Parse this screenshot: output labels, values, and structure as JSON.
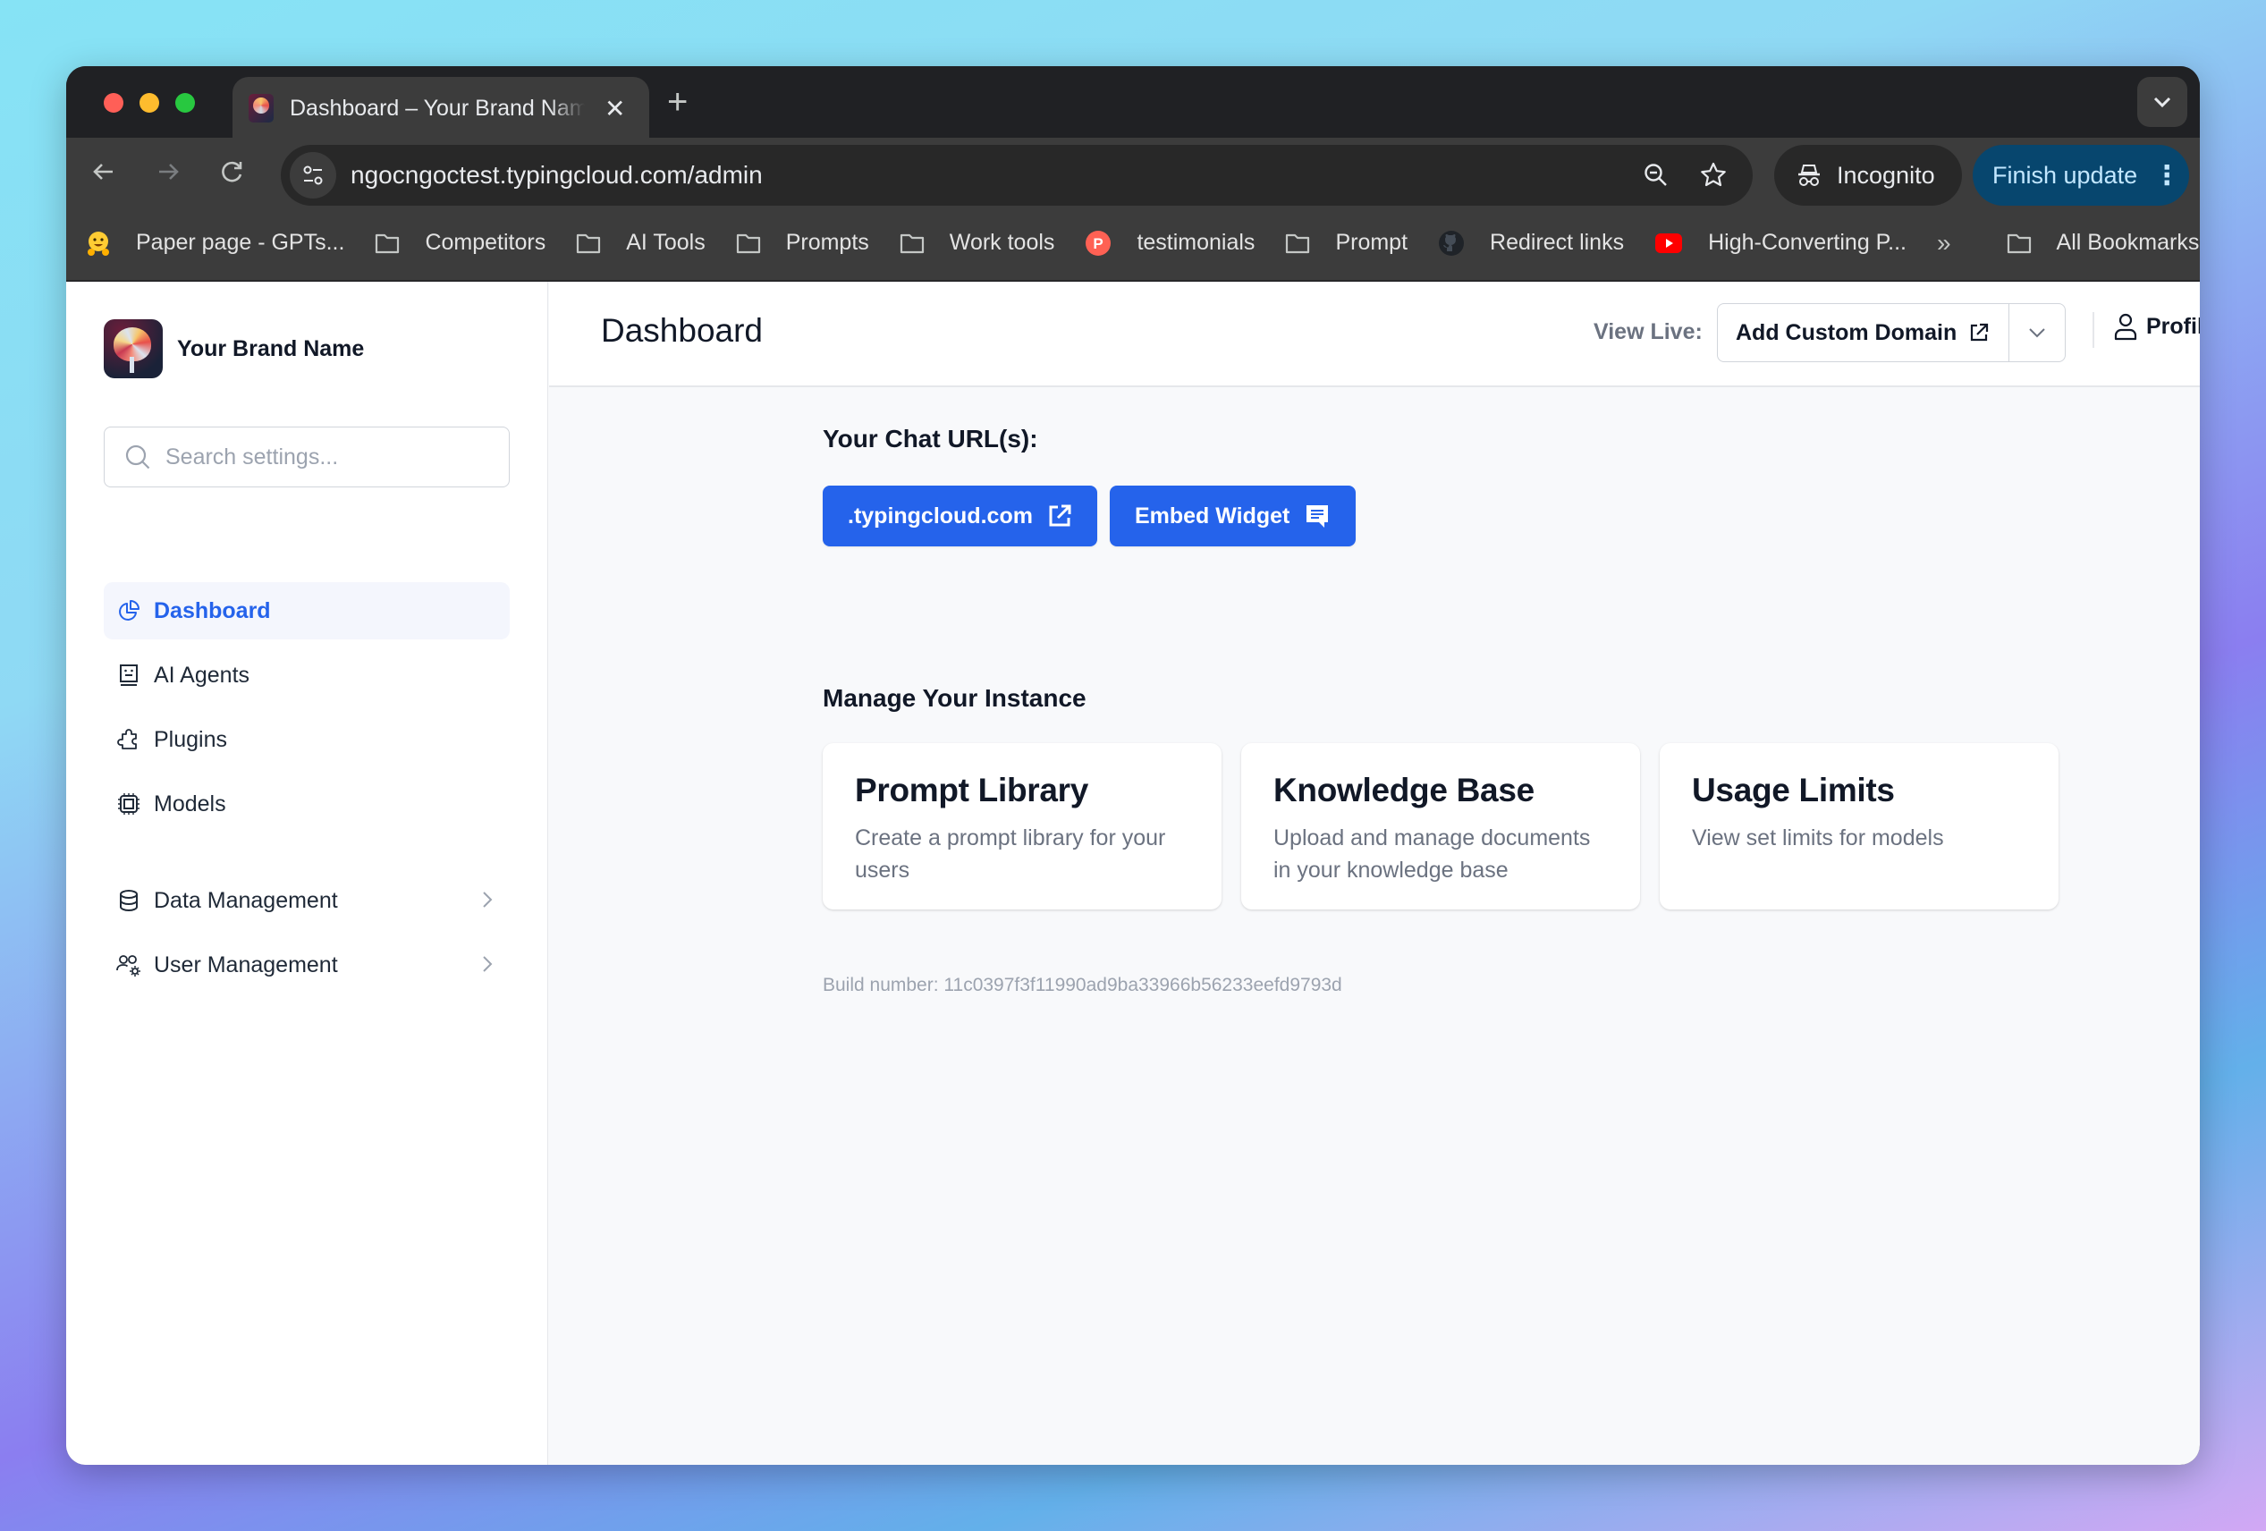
{
  "browser": {
    "tab_title": "Dashboard – Your Brand Name",
    "new_tab_symbol": "+",
    "close_symbol": "✕",
    "url": "ngocngoctest.typingcloud.com/admin",
    "incognito_label": "Incognito",
    "finish_update_label": "Finish update",
    "bookmarks": [
      {
        "label": "Paper page - GPTs...",
        "icon": "huggingface-icon"
      },
      {
        "label": "Competitors",
        "icon": "folder-icon"
      },
      {
        "label": "AI Tools",
        "icon": "folder-icon"
      },
      {
        "label": "Prompts",
        "icon": "folder-icon"
      },
      {
        "label": "Work tools",
        "icon": "folder-icon"
      },
      {
        "label": "testimonials",
        "icon": "producthunt-icon"
      },
      {
        "label": "Prompt",
        "icon": "folder-icon"
      },
      {
        "label": "Redirect links",
        "icon": "github-icon"
      },
      {
        "label": "High-Converting P...",
        "icon": "youtube-icon"
      }
    ],
    "more_bookmarks_symbol": "»",
    "all_bookmarks_label": "All Bookmarks"
  },
  "sidebar": {
    "brand_name": "Your Brand Name",
    "search_placeholder": "Search settings...",
    "items": [
      {
        "label": "Dashboard",
        "icon": "pie-chart-icon",
        "active": true
      },
      {
        "label": "AI Agents",
        "icon": "robot-icon"
      },
      {
        "label": "Plugins",
        "icon": "puzzle-icon"
      },
      {
        "label": "Models",
        "icon": "cpu-chip-icon"
      }
    ],
    "groups": [
      {
        "label": "Data Management",
        "icon": "database-icon"
      },
      {
        "label": "User Management",
        "icon": "users-gear-icon"
      }
    ]
  },
  "header": {
    "title": "Dashboard",
    "view_live_label": "View Live:",
    "custom_domain_label": "Add Custom Domain",
    "profile_label": "Profile"
  },
  "main": {
    "chat_urls_title": "Your Chat URL(s):",
    "chat_url_button": ".typingcloud.com",
    "embed_widget_button": "Embed Widget",
    "manage_title": "Manage Your Instance",
    "cards": [
      {
        "title": "Prompt Library",
        "description": "Create a prompt library for your users"
      },
      {
        "title": "Knowledge Base",
        "description": "Upload and manage documents in your knowledge base"
      },
      {
        "title": "Usage Limits",
        "description": "View set limits for models"
      }
    ],
    "build_number": "Build number: 11c0397f3f11990ad9ba33966b56233eefd9793d"
  },
  "colors": {
    "accent": "#2563eb",
    "update_button": "#07466e"
  }
}
